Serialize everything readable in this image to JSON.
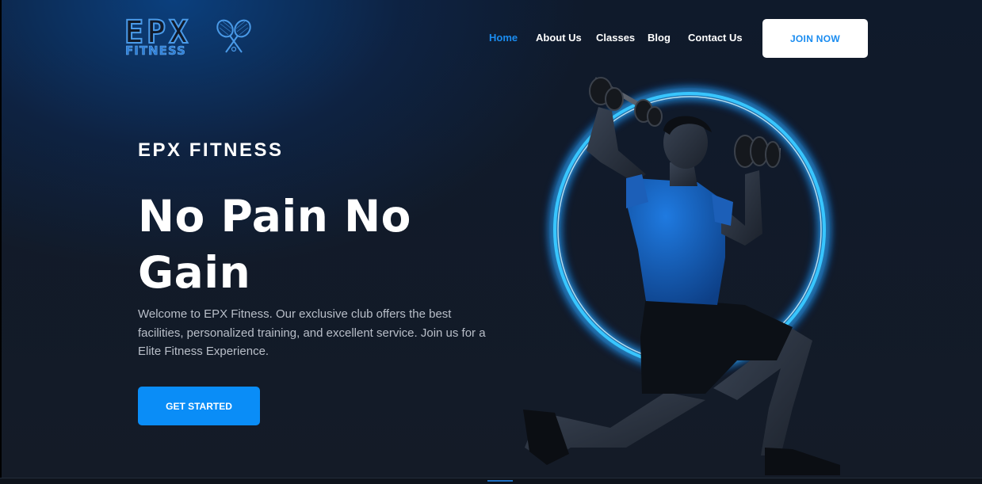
{
  "logo": {
    "wordmark": "EPX",
    "subtext": "FITNESS",
    "icon": "crossed-rackets-icon"
  },
  "nav": {
    "items": [
      {
        "label": "Home",
        "active": true
      },
      {
        "label": "About Us",
        "active": false
      },
      {
        "label": "Classes",
        "active": false
      },
      {
        "label": "Blog",
        "active": false
      },
      {
        "label": "Contact Us",
        "active": false
      }
    ],
    "join_label": "JOIN NOW"
  },
  "hero": {
    "brand": "EPX FITNESS",
    "headline": "No Pain No Gain",
    "intro": "Welcome to EPX Fitness. Our exclusive club offers the best facilities, personalized training, and excellent service. Join us for a Elite Fitness Experience.",
    "cta_label": "GET STARTED",
    "image": "athlete-lunge-dumbbells-glowing-ring"
  },
  "colors": {
    "accent": "#0a8df7",
    "nav_active": "#1a8cf0",
    "background": "#131a26",
    "ring_glow": "#38c6ff"
  }
}
